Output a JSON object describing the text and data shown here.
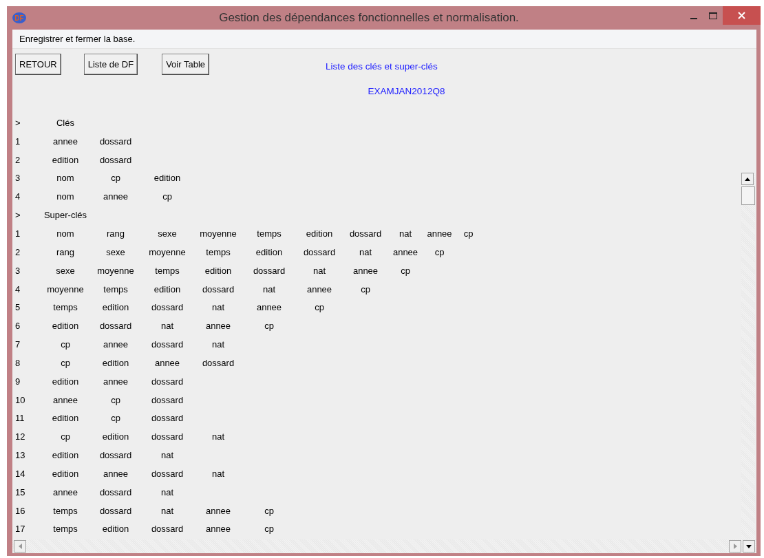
{
  "window": {
    "title": "Gestion des dépendances fonctionnelles et normalisation.",
    "icon_text": "DF"
  },
  "menu": [
    "Enregistrer et fermer la base."
  ],
  "buttons": [
    "RETOUR",
    "Liste de DF",
    "Voir Table"
  ],
  "heading": "Liste des clés et super-clés",
  "table_name": "EXAMJAN2012Q8",
  "sections": [
    {
      "marker": ">",
      "title": "Clés",
      "rows": [
        {
          "number": "1",
          "attributes": [
            "annee",
            "dossard"
          ]
        },
        {
          "number": "2",
          "attributes": [
            "edition",
            "dossard"
          ]
        },
        {
          "number": "3",
          "attributes": [
            "nom",
            "cp",
            "edition"
          ]
        },
        {
          "number": "4",
          "attributes": [
            "nom",
            "annee",
            "cp"
          ]
        }
      ]
    },
    {
      "marker": ">",
      "title": "Super-clés",
      "rows": [
        {
          "number": "1",
          "attributes": [
            "nom",
            "rang",
            "sexe",
            "moyenne",
            "temps",
            "edition",
            "dossard",
            "nat",
            "annee",
            "cp"
          ]
        },
        {
          "number": "2",
          "attributes": [
            "rang",
            "sexe",
            "moyenne",
            "temps",
            "edition",
            "dossard",
            "nat",
            "annee",
            "cp"
          ]
        },
        {
          "number": "3",
          "attributes": [
            "sexe",
            "moyenne",
            "temps",
            "edition",
            "dossard",
            "nat",
            "annee",
            "cp"
          ]
        },
        {
          "number": "4",
          "attributes": [
            "moyenne",
            "temps",
            "edition",
            "dossard",
            "nat",
            "annee",
            "cp"
          ]
        },
        {
          "number": "5",
          "attributes": [
            "temps",
            "edition",
            "dossard",
            "nat",
            "annee",
            "cp"
          ]
        },
        {
          "number": "6",
          "attributes": [
            "edition",
            "dossard",
            "nat",
            "annee",
            "cp"
          ]
        },
        {
          "number": "7",
          "attributes": [
            "cp",
            "annee",
            "dossard",
            "nat"
          ]
        },
        {
          "number": "8",
          "attributes": [
            "cp",
            "edition",
            "annee",
            "dossard"
          ]
        },
        {
          "number": "9",
          "attributes": [
            "edition",
            "annee",
            "dossard"
          ]
        },
        {
          "number": "10",
          "attributes": [
            "annee",
            "cp",
            "dossard"
          ]
        },
        {
          "number": "11",
          "attributes": [
            "edition",
            "cp",
            "dossard"
          ]
        },
        {
          "number": "12",
          "attributes": [
            "cp",
            "edition",
            "dossard",
            "nat"
          ]
        },
        {
          "number": "13",
          "attributes": [
            "edition",
            "dossard",
            "nat"
          ]
        },
        {
          "number": "14",
          "attributes": [
            "edition",
            "annee",
            "dossard",
            "nat"
          ]
        },
        {
          "number": "15",
          "attributes": [
            "annee",
            "dossard",
            "nat"
          ]
        },
        {
          "number": "16",
          "attributes": [
            "temps",
            "dossard",
            "nat",
            "annee",
            "cp"
          ]
        },
        {
          "number": "17",
          "attributes": [
            "temps",
            "edition",
            "dossard",
            "annee",
            "cp"
          ]
        }
      ]
    }
  ]
}
